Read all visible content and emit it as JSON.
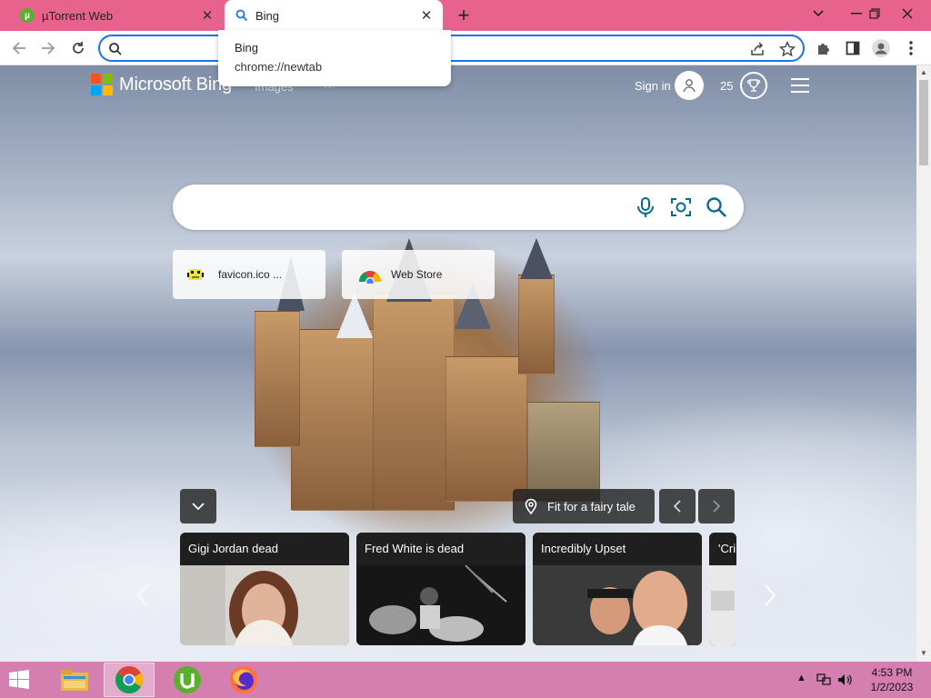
{
  "browser": {
    "tabs": [
      {
        "title": "µTorrent Web",
        "active": false,
        "favicon": "utorrent-icon"
      },
      {
        "title": "Bing",
        "active": true,
        "favicon": "search-icon"
      }
    ],
    "new_tab_label": "+",
    "window_controls": {
      "dropdown": "⌄",
      "minimize": "—",
      "restore": "❐",
      "close": "✕"
    },
    "omnibox": {
      "value": "",
      "placeholder": ""
    },
    "suggestion": {
      "title": "Bing",
      "url": "chrome://newtab"
    },
    "accent_color": "#1a73e8",
    "tabstrip_color": "#e8628e"
  },
  "bing": {
    "brand": "Microsoft Bing",
    "nav_links": [
      "Images",
      "···"
    ],
    "sign_in": "Sign in",
    "points": "25",
    "search": {
      "value": "",
      "placeholder": ""
    },
    "tiles": [
      {
        "label": "favicon.ico ...",
        "icon": "favicon-icon"
      },
      {
        "label": "Web Store",
        "icon": "chrome-web-store-icon"
      }
    ],
    "caption": "Fit for a fairy tale",
    "news": [
      {
        "title": "Gigi Jordan dead"
      },
      {
        "title": "Fred White is dead"
      },
      {
        "title": "Incredibly Upset"
      },
      {
        "title": "'Cri"
      }
    ]
  },
  "taskbar": {
    "apps": [
      "file-explorer-icon",
      "chrome-icon",
      "utorrent-icon",
      "firefox-icon"
    ],
    "time": "4:53 PM",
    "date": "1/2/2023",
    "color": "#d57fb1"
  }
}
